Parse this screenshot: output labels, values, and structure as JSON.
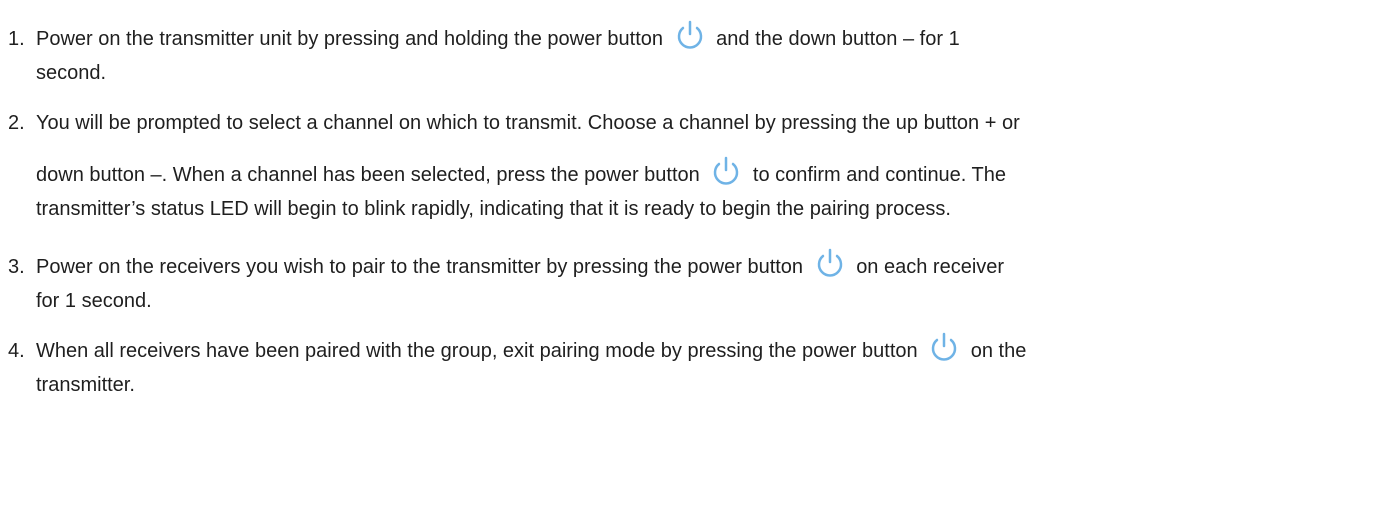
{
  "icon": "power-icon",
  "accent_color": "#6fb3e6",
  "steps": [
    {
      "number": "1.",
      "line1_before": "Power on the transmitter unit by pressing and holding the power button",
      "line1_after": "and the down button – for 1",
      "line2": "second."
    },
    {
      "number": "2.",
      "line1": "You will be prompted to select a channel on which to transmit. Choose a channel by pressing the up button + or",
      "line2_before": "down button –. When a channel has been selected, press the power button",
      "line2_after": "to confirm and continue. The",
      "line3": "transmitter’s status LED will begin to blink rapidly, indicating that it is ready to begin the pairing process."
    },
    {
      "number": "3.",
      "line1_before": "Power on the receivers you wish to pair to the transmitter by pressing the power button",
      "line1_after": "on each receiver",
      "line2": "for 1 second."
    },
    {
      "number": "4.",
      "line1_before": "When all receivers have been paired with the group, exit pairing mode by pressing the power button",
      "line1_after": "on the",
      "line2": "transmitter."
    }
  ]
}
